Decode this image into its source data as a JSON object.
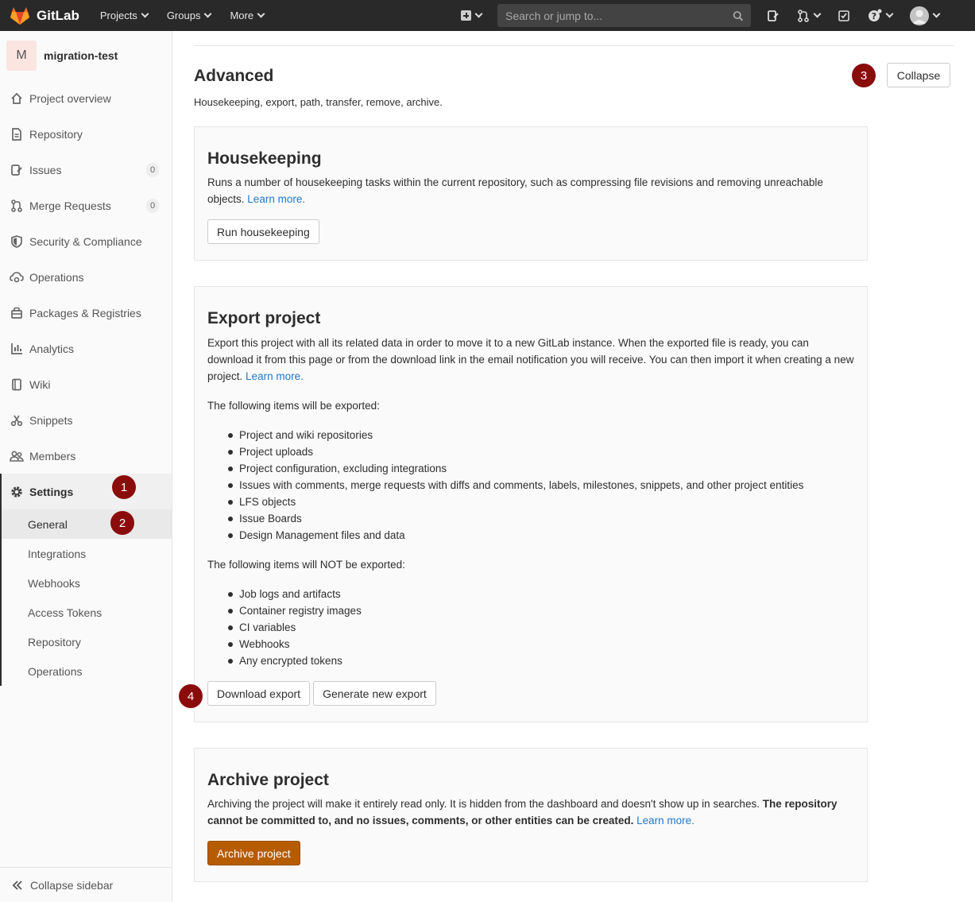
{
  "navbar": {
    "brand": "GitLab",
    "menu": [
      {
        "label": "Projects"
      },
      {
        "label": "Groups"
      },
      {
        "label": "More"
      }
    ],
    "search_placeholder": "Search or jump to..."
  },
  "sidebar": {
    "project_initial": "M",
    "project_name": "migration-test",
    "items": [
      {
        "label": "Project overview",
        "icon": "home-icon"
      },
      {
        "label": "Repository",
        "icon": "document-icon"
      },
      {
        "label": "Issues",
        "icon": "issues-icon",
        "count": "0"
      },
      {
        "label": "Merge Requests",
        "icon": "merge-request-icon",
        "count": "0"
      },
      {
        "label": "Security & Compliance",
        "icon": "shield-icon"
      },
      {
        "label": "Operations",
        "icon": "cloud-gear-icon"
      },
      {
        "label": "Packages & Registries",
        "icon": "package-icon"
      },
      {
        "label": "Analytics",
        "icon": "chart-icon"
      },
      {
        "label": "Wiki",
        "icon": "book-icon"
      },
      {
        "label": "Snippets",
        "icon": "scissors-icon"
      },
      {
        "label": "Members",
        "icon": "users-icon"
      }
    ],
    "settings_label": "Settings",
    "settings_sub": [
      "General",
      "Integrations",
      "Webhooks",
      "Access Tokens",
      "Repository",
      "Operations"
    ],
    "collapse_label": "Collapse sidebar"
  },
  "main": {
    "title": "Advanced",
    "subtitle": "Housekeeping, export, path, transfer, remove, archive.",
    "collapse_button": "Collapse",
    "housekeeping": {
      "title": "Housekeeping",
      "text": "Runs a number of housekeeping tasks within the current repository, such as compressing file revisions and removing unreachable objects.",
      "learn_more": "Learn more.",
      "button": "Run housekeeping"
    },
    "export": {
      "title": "Export project",
      "text": "Export this project with all its related data in order to move it to a new GitLab instance. When the exported file is ready, you can download it from this page or from the download link in the email notification you will receive. You can then import it when creating a new project.",
      "learn_more": "Learn more.",
      "exported_heading": "The following items will be exported:",
      "exported_items": [
        "Project and wiki repositories",
        "Project uploads",
        "Project configuration, excluding integrations",
        "Issues with comments, merge requests with diffs and comments, labels, milestones, snippets, and other project entities",
        "LFS objects",
        "Issue Boards",
        "Design Management files and data"
      ],
      "not_exported_heading": "The following items will NOT be exported:",
      "not_exported_items": [
        "Job logs and artifacts",
        "Container registry images",
        "CI variables",
        "Webhooks",
        "Any encrypted tokens"
      ],
      "download_button": "Download export",
      "generate_button": "Generate new export"
    },
    "archive": {
      "title": "Archive project",
      "text": "Archiving the project will make it entirely read only. It is hidden from the dashboard and doesn't show up in searches.",
      "bold_text": "The repository cannot be committed to, and no issues, comments, or other entities can be created.",
      "learn_more": "Learn more.",
      "button": "Archive project"
    }
  },
  "annotations": [
    "1",
    "2",
    "3",
    "4"
  ]
}
